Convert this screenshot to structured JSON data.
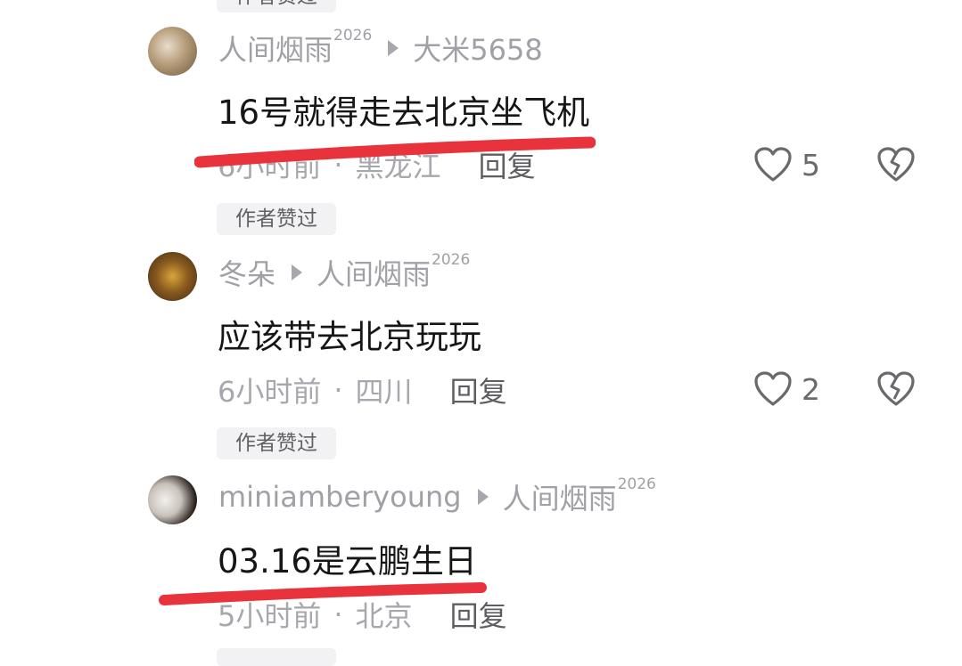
{
  "comments": [
    {
      "user": "人间烟雨",
      "user_suffix": "2026",
      "reply_to": "大米5658",
      "reply_to_suffix": "",
      "text": "16号就得走去北京坐飞机",
      "time": "6小时前",
      "location": "黑龙江",
      "reply_label": "回复",
      "likes": "5",
      "author_liked": "作者赞过"
    },
    {
      "user": "冬朵",
      "user_suffix": "",
      "reply_to": "人间烟雨",
      "reply_to_suffix": "2026",
      "text": "应该带去北京玩玩",
      "time": "6小时前",
      "location": "四川",
      "reply_label": "回复",
      "likes": "2",
      "author_liked": "作者赞过"
    },
    {
      "user": "miniamberyoung",
      "user_suffix": "",
      "reply_to": "人间烟雨",
      "reply_to_suffix": "2026",
      "text": "03.16是云鹏生日",
      "time": "5小时前",
      "location": "北京",
      "reply_label": "回复"
    }
  ],
  "top_tag": "作者赞过",
  "dot": "·",
  "colors": {
    "underline": "#e8323c",
    "muted": "#a0a0a6",
    "text": "#161616"
  },
  "icons": {
    "like": "heart-outline-icon",
    "dislike": "broken-heart-icon",
    "arrow": "play-triangle-icon"
  }
}
